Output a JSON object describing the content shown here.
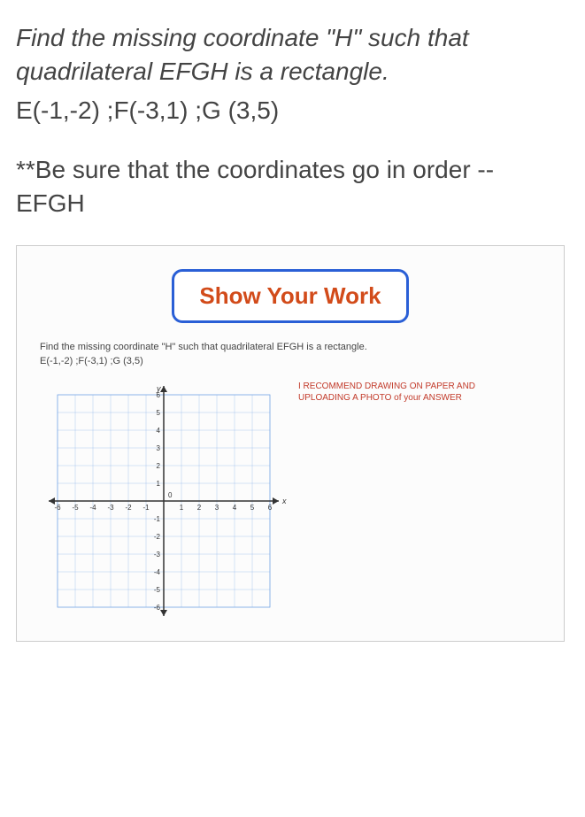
{
  "question": "Find the missing coordinate \"H\" such that quadrilateral EFGH is a rectangle.",
  "coords": "E(-1,-2) ;F(-3,1) ;G (3,5)",
  "note": "**Be sure that the coordinates go in order -- EFGH",
  "show_work_label": "Show Your Work",
  "inner_prompt": "Find the missing coordinate \"H\" such that quadrilateral EFGH is a rectangle.",
  "inner_coords": "E(-1,-2) ;F(-3,1) ;G (3,5)",
  "recommend": "I RECOMMEND DRAWING ON PAPER AND UPLOADING A PHOTO of your ANSWER",
  "chart_data": {
    "type": "scatter",
    "title": "",
    "xlabel": "x",
    "ylabel": "y",
    "xlim": [
      -6,
      6
    ],
    "ylim": [
      -6,
      6
    ],
    "x_ticks": [
      -6,
      -5,
      -4,
      -3,
      -2,
      -1,
      0,
      1,
      2,
      3,
      4,
      5,
      6
    ],
    "y_ticks": [
      -6,
      -5,
      -4,
      -3,
      -2,
      -1,
      0,
      1,
      2,
      3,
      4,
      5,
      6
    ],
    "series": []
  }
}
